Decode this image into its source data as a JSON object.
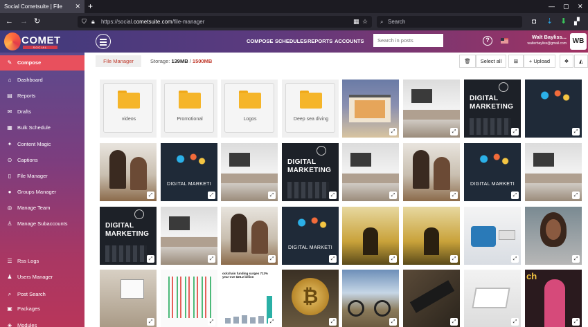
{
  "browser": {
    "tab_title": "Social Cometsuite | File Manager",
    "url_prefix": "https://social.",
    "url_domain": "cometsuite.com",
    "url_path": "/file-manager",
    "search_placeholder": "Search"
  },
  "header": {
    "logo_text": "COMET",
    "logo_sub": "SOCIAL",
    "nav": [
      "COMPOSE",
      "SCHEDULES",
      "REPORTS",
      "ACCOUNTS"
    ],
    "search_placeholder": "Search in posts",
    "user_name": "Walt Bayliss...",
    "user_email": "walterbayliss@gmail.com",
    "avatar_initials": "WB"
  },
  "sidebar": {
    "items": [
      {
        "label": "Compose",
        "icon": "pencil-icon",
        "active": true
      },
      {
        "label": "Dashboard",
        "icon": "dashboard-icon"
      },
      {
        "label": "Reports",
        "icon": "reports-icon"
      },
      {
        "label": "Drafts",
        "icon": "drafts-icon"
      },
      {
        "label": "Bulk Schedule",
        "icon": "bulk-schedule-icon"
      },
      {
        "label": "Content Magic",
        "icon": "content-magic-icon"
      },
      {
        "label": "Captions",
        "icon": "captions-icon"
      },
      {
        "label": "File Manager",
        "icon": "file-icon"
      },
      {
        "label": "Groups Manager",
        "icon": "groups-icon"
      },
      {
        "label": "Manage Team",
        "icon": "team-icon"
      },
      {
        "label": "Manage Subaccounts",
        "icon": "user-icon"
      },
      {
        "label": "Rss Logs",
        "icon": "rss-icon"
      },
      {
        "label": "Users Manager",
        "icon": "users-icon"
      },
      {
        "label": "Post Search",
        "icon": "search-icon"
      },
      {
        "label": "Packages",
        "icon": "packages-icon"
      },
      {
        "label": "Modules",
        "icon": "modules-icon"
      }
    ]
  },
  "file_manager": {
    "tab_label": "File Manager",
    "storage_label": "Storage:",
    "storage_used": "139MB",
    "storage_sep": " / ",
    "storage_max": "1500MB",
    "select_all_label": "Select all",
    "upload_label": "+ Upload",
    "folders": [
      "videos",
      "Promotional",
      "Logos",
      "Deep sea diving"
    ],
    "dm_line1": "DIGITAL",
    "dm_line2": "MARKETING",
    "dm_caption": "DIGITAL MARKETI",
    "news_headline": "ockchain funding surges 713% year-ove $25.2 billion",
    "btc_symbol": "₿",
    "pres_glyph": "ch"
  }
}
